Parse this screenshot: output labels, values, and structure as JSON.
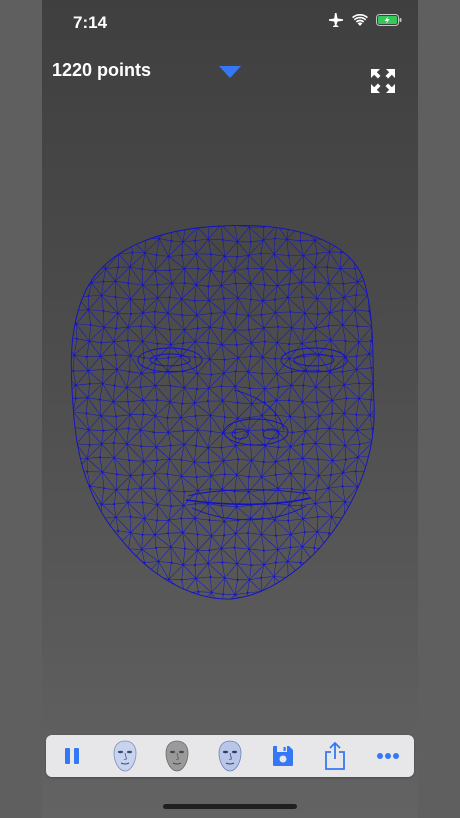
{
  "status_bar": {
    "time": "7:14",
    "icons": [
      "airplane-icon",
      "wifi-icon",
      "battery-charging-icon"
    ]
  },
  "header": {
    "points_label": "1220 points",
    "dropdown_icon": "triangle-down-icon",
    "fullscreen_icon": "expand-arrows-icon"
  },
  "viewer": {
    "subject": "face-mesh-wireframe",
    "mesh_color": "#1010c8"
  },
  "toolbar": {
    "buttons": [
      {
        "icon": "pause-icon"
      },
      {
        "icon": "face-textured-icon"
      },
      {
        "icon": "face-gray-icon"
      },
      {
        "icon": "face-shaded-icon"
      },
      {
        "icon": "save-icon"
      },
      {
        "icon": "share-icon"
      },
      {
        "icon": "more-icon"
      }
    ]
  },
  "colors": {
    "accent": "#3478f6",
    "toolbar_bg": "#e7e7ea",
    "background": "#4a4a4a"
  }
}
